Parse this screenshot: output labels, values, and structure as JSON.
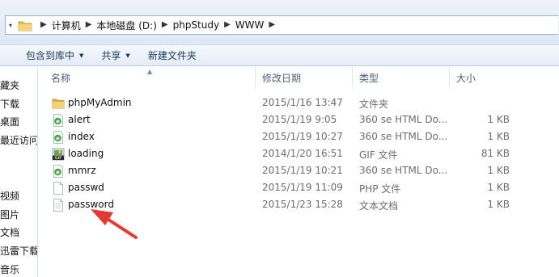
{
  "address": {
    "crumbs": [
      "计算机",
      "本地磁盘 (D:)",
      "phpStudy",
      "WWW"
    ]
  },
  "toolbar": {
    "include_in_library": "包含到库中",
    "share": "共享",
    "new_folder": "新建文件夹"
  },
  "nav": {
    "items": [
      "藏夹",
      "下载",
      "桌面",
      "最近访问",
      "视频",
      "图片",
      "文档",
      "迅雷下载",
      "音乐"
    ]
  },
  "columns": {
    "name": "名称",
    "date": "修改日期",
    "type": "类型",
    "size": "大小"
  },
  "files": [
    {
      "name": "phpMyAdmin",
      "date": "2015/1/16 13:47",
      "type": "文件夹",
      "size": "",
      "icon": "folder-icon"
    },
    {
      "name": "alert",
      "date": "2015/1/19 9:05",
      "type": "360 se HTML Do...",
      "size": "1 KB",
      "icon": "html-document-icon"
    },
    {
      "name": "index",
      "date": "2015/1/19 10:27",
      "type": "360 se HTML Do...",
      "size": "1 KB",
      "icon": "html-document-icon"
    },
    {
      "name": "loading",
      "date": "2014/1/20 16:51",
      "type": "GIF 文件",
      "size": "81 KB",
      "icon": "gif-image-icon"
    },
    {
      "name": "mmrz",
      "date": "2015/1/19 10:21",
      "type": "360 se HTML Do...",
      "size": "1 KB",
      "icon": "html-document-icon"
    },
    {
      "name": "passwd",
      "date": "2015/1/19 11:09",
      "type": "PHP 文件",
      "size": "1 KB",
      "icon": "blank-file-icon"
    },
    {
      "name": "password",
      "date": "2015/1/23 15:28",
      "type": "文本文档",
      "size": "1 KB",
      "icon": "text-file-icon"
    }
  ],
  "colors": {
    "annotation_arrow": "#e53935",
    "folder": "#f0c35a",
    "html_icon": "#3aa63a"
  }
}
